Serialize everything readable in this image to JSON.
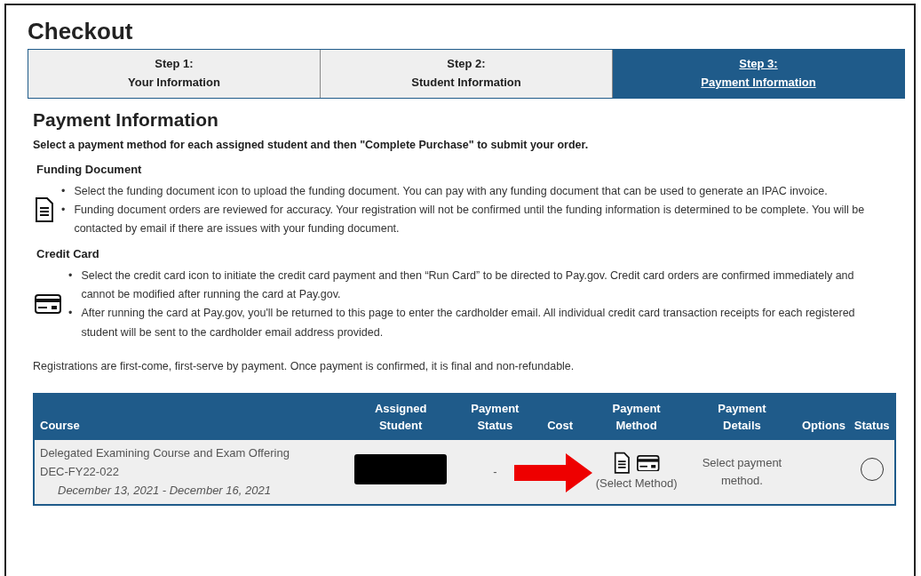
{
  "page": {
    "title": "Checkout"
  },
  "steps": [
    {
      "label": "Step 1:",
      "sublabel": "Your Information",
      "selected": false
    },
    {
      "label": "Step 2:",
      "sublabel": "Student Information",
      "selected": false
    },
    {
      "label": "Step 3:",
      "sublabel": "Payment Information",
      "selected": true
    }
  ],
  "section": {
    "heading": "Payment Information",
    "instruction": "Select a payment method for each assigned student and then \"Complete Purchase\" to submit your order."
  },
  "methods": [
    {
      "kind": "document",
      "heading": "Funding Document",
      "marker": "•",
      "bullets": [
        "Select the funding document icon to upload the funding document. You can pay with any funding document that can be used to generate an IPAC invoice.",
        "Funding document orders are reviewed for accuracy. Your registration will not be confirmed until the funding information is determined to be complete. You will be contacted by email if there are issues with your funding document."
      ]
    },
    {
      "kind": "card",
      "heading": "Credit Card",
      "marker": "•",
      "bullets": [
        "Select the credit card icon to initiate the credit card payment and then “Run Card” to be directed to Pay.gov. Credit card orders are confirmed immediately and cannot be modified after running the card at Pay.gov.",
        "After running the card at Pay.gov, you'll be returned to this page to enter the cardholder email. All individual credit card transaction receipts for each registered student will be sent to the cardholder email address provided."
      ]
    }
  ],
  "notice": "Registrations are first-come, first-serve by payment. Once payment is confirmed, it is final and non-refundable.",
  "table": {
    "columns": [
      [
        "Course"
      ],
      [
        "Assigned",
        "Student"
      ],
      [
        "Payment",
        "Status"
      ],
      [
        "Cost"
      ],
      [
        "Payment",
        "Method"
      ],
      [
        "Payment",
        "Details"
      ],
      [
        "Options"
      ],
      [
        "Status"
      ]
    ],
    "rows": [
      {
        "course": "Delegated Examining Course and Exam Offering",
        "code": "DEC-FY22-022",
        "dates": "December 13, 2021 - December 16, 2021",
        "student_redacted": true,
        "payment_status": "-",
        "method_label": "(Select Method)",
        "details": "Select payment method.",
        "complete": false
      }
    ]
  },
  "annotation": {
    "arrow": true
  }
}
